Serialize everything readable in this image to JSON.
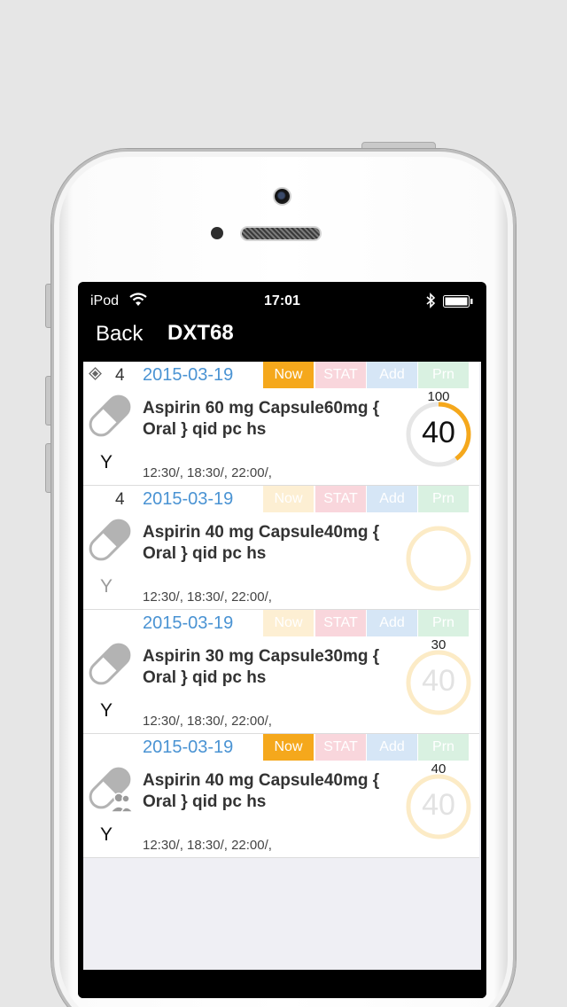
{
  "status": {
    "carrier": "iPod",
    "time": "17:01"
  },
  "nav": {
    "back": "Back",
    "title": "DXT68"
  },
  "rows": [
    {
      "count": "4",
      "date": "2015-03-19",
      "tags": {
        "now": "Now",
        "stat": "STAT",
        "add": "Add",
        "prn": "Prn"
      },
      "title": "Aspirin 60 mg Capsule60mg  { Oral }   qid pc hs",
      "flag": "Y",
      "times": "12:30/, 18:30/, 22:00/,",
      "ring_top": "100",
      "ring_value": "40",
      "progress": 0.4
    },
    {
      "count": "4",
      "date": "2015-03-19",
      "tags": {
        "now": "Now",
        "stat": "STAT",
        "add": "Add",
        "prn": "Prn"
      },
      "title": "Aspirin 40 mg Capsule40mg  { Oral }   qid pc hs",
      "flag": "Y",
      "times": "12:30/, 18:30/, 22:00/,",
      "ring_top": "",
      "ring_value": "",
      "progress": 0
    },
    {
      "count": "",
      "date": "2015-03-19",
      "tags": {
        "now": "Now",
        "stat": "STAT",
        "add": "Add",
        "prn": "Prn"
      },
      "title": "Aspirin 30 mg Capsule30mg  { Oral }   qid pc hs",
      "flag": "Y",
      "times": "12:30/, 18:30/, 22:00/,",
      "ring_top": "30",
      "ring_value": "40",
      "progress": 0
    },
    {
      "count": "",
      "date": "2015-03-19",
      "tags": {
        "now": "Now",
        "stat": "STAT",
        "add": "Add",
        "prn": "Prn"
      },
      "title": "Aspirin 40 mg Capsule40mg  { Oral }   qid pc hs",
      "flag": "Y",
      "times": "12:30/, 18:30/, 22:00/,",
      "ring_top": "40",
      "ring_value": "40",
      "progress": 0
    }
  ],
  "colors": {
    "now": "#f5a81c",
    "now_faded": "#fdefd3",
    "stat": "#f9d6dc",
    "add": "#d6e6f6",
    "prn": "#d9f1e1",
    "ring_track": "#e6e6e6",
    "ring_faded": "#fcebc6",
    "accent": "#f5a81c",
    "date": "#4a93d3"
  }
}
